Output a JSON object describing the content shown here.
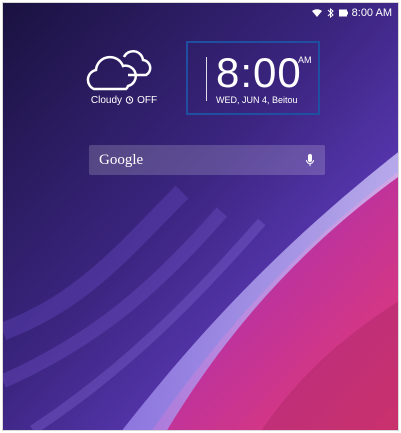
{
  "status_bar": {
    "time": "8:00 AM",
    "icons": [
      "wifi-icon",
      "bluetooth-icon",
      "battery-icon"
    ]
  },
  "weather": {
    "icon": "cloud-icon",
    "condition": "Cloudy",
    "alarm_icon": "alarm-icon",
    "alarm_status": "OFF"
  },
  "clock": {
    "time": "8:00",
    "ampm": "AM",
    "date_location": "WED, JUN 4, Beitou",
    "highlight_color": "#1f4fa0"
  },
  "search": {
    "label": "Google",
    "mic_icon": "microphone-icon"
  },
  "colors": {
    "wallpaper_dark": "#1b1140",
    "wallpaper_purple": "#6a3bd0",
    "wallpaper_magenta": "#d22a7a"
  }
}
